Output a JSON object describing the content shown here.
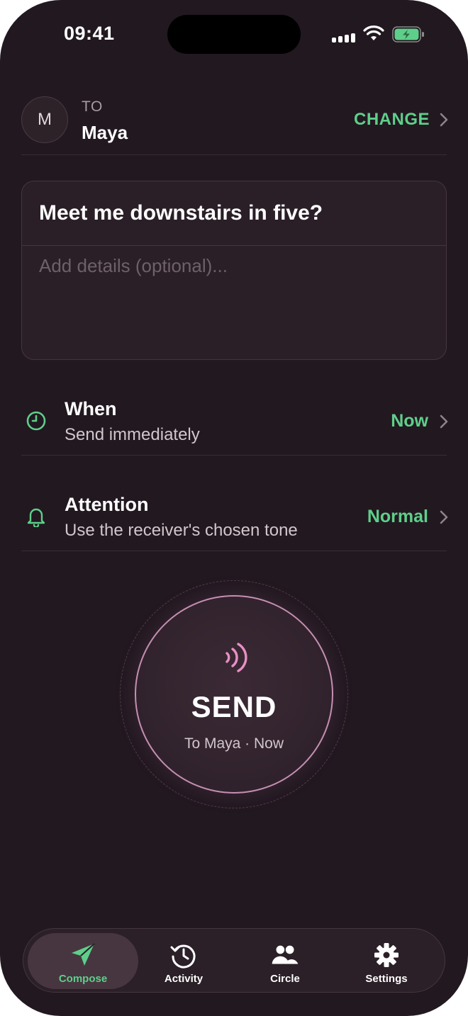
{
  "status": {
    "time": "09:41"
  },
  "recipient": {
    "initial": "M",
    "to_label": "TO",
    "name": "Maya",
    "change_label": "CHANGE"
  },
  "message": {
    "title": "Meet me downstairs in five?",
    "details_placeholder": "Add details (optional)...",
    "details_value": ""
  },
  "options": [
    {
      "title": "When",
      "subtitle": "Send immediately",
      "value": "Now",
      "icon": "clock-icon"
    },
    {
      "title": "Attention",
      "subtitle": "Use the receiver's chosen tone",
      "value": "Normal",
      "icon": "bell-icon"
    }
  ],
  "send": {
    "label": "SEND",
    "subtitle": "To Maya · Now",
    "icon": "signal-waves-icon"
  },
  "tabs": [
    {
      "label": "Compose",
      "icon": "paper-plane-icon",
      "active": true
    },
    {
      "label": "Activity",
      "icon": "history-clock-icon",
      "active": false
    },
    {
      "label": "Circle",
      "icon": "people-icon",
      "active": false
    },
    {
      "label": "Settings",
      "icon": "gear-icon",
      "active": false
    }
  ],
  "colors": {
    "background": "#221820",
    "accent_green": "#5ecf8a",
    "accent_pink": "#e88fc4"
  }
}
